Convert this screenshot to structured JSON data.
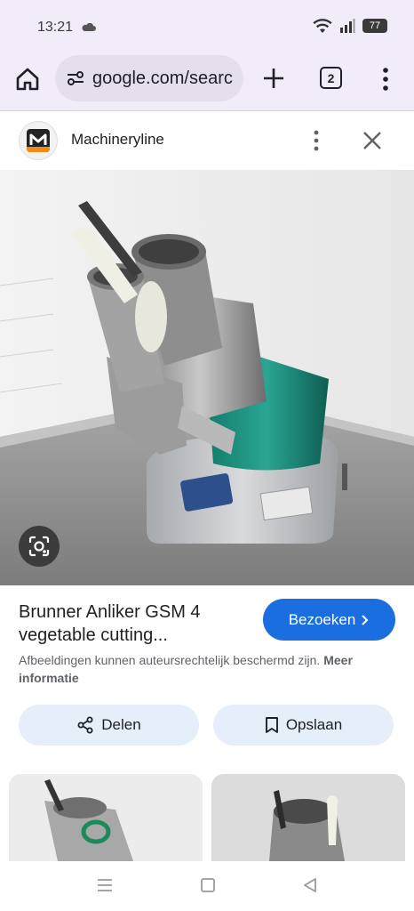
{
  "status_bar": {
    "time": "13:21",
    "battery": "77"
  },
  "browser": {
    "url": "google.com/searc",
    "tab_count": "2"
  },
  "source": {
    "site_name": "Machineryline"
  },
  "result": {
    "title": "Brunner Anliker GSM 4 vegetable cutting...",
    "visit_label": "Bezoeken",
    "disclaimer": "Afbeeldingen kunnen auteursrechtelijk beschermd zijn.",
    "more_info": "Meer informatie",
    "share_label": "Delen",
    "save_label": "Opslaan"
  },
  "colors": {
    "accent": "#1a6ee0",
    "chrome": "#f1ecf7",
    "button_bg": "#e6eefa"
  },
  "icons": [
    "cloud-icon",
    "wifi-icon",
    "signal-icon",
    "battery-icon",
    "home-icon",
    "tune-icon",
    "plus-icon",
    "tabs-icon",
    "more-vert-icon",
    "close-icon",
    "lens-icon",
    "chevron-right-icon",
    "share-icon",
    "bookmark-icon",
    "recents-icon",
    "home-nav-icon",
    "back-icon"
  ]
}
